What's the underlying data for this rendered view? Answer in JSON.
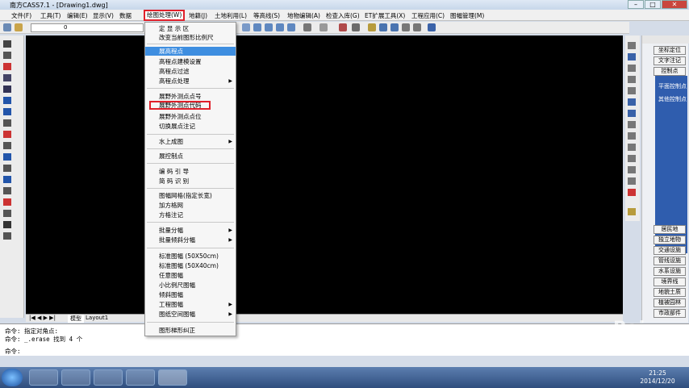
{
  "window": {
    "title": "南方CASS7.1 - [Drawing1.dwg]",
    "minimize": "–",
    "maximize": "□",
    "close": "✕"
  },
  "menubar": [
    "文件(F)",
    "工具(T)",
    "编辑(E)",
    "显示(V)",
    "数据",
    "绘图处理(W)",
    "地籍(J)",
    "土地利用(L)",
    "等高线(S)",
    "地物编辑(A)",
    "检查入库(G)",
    "ET扩展工具(X)",
    "工程应用(C)",
    "图幅管理(M)"
  ],
  "layer_value": "0",
  "dropdown": {
    "items": [
      "定 显 示 区",
      "改变当前图形比例尺",
      "展高程点",
      "高程点建模设置",
      "高程点过滤",
      "高程点处理",
      "展野外测点点号",
      "展野外测点代码",
      "展野外测点点位",
      "切换展点注记",
      "水上成图",
      "展控制点",
      "编 码 引 导",
      "简 码 识 别",
      "图幅网格(指定长宽)",
      "加方格网",
      "方格注记",
      "批量分幅",
      "批量倾斜分幅",
      "标准图幅 (50X50cm)",
      "标准图幅 (50X40cm)",
      "任意图幅",
      "小比例尺图幅",
      "倾斜图幅",
      "工程图幅",
      "图纸空间图幅",
      "图形梯形纠正"
    ]
  },
  "tabs": {
    "model": "模型",
    "layout": "Layout1"
  },
  "command": {
    "line1": "命令: 指定对角点:",
    "line2": "命令: _.erase 找到 4 个",
    "prompt": "命令:"
  },
  "right_panel": {
    "top_buttons": [
      "坐标定位",
      "文字注记",
      "控制点"
    ],
    "blue_items": [
      "平面控制点",
      "其他控制点"
    ],
    "bottom_buttons": [
      "居民地",
      "独立地物",
      "交通设施",
      "管线设施",
      "水系设施",
      "境界线",
      "地貌土质",
      "植被园林",
      "市政部件"
    ]
  },
  "taskbar": {
    "time": "21:25",
    "date": "2014/12/20"
  },
  "watermark": "Bai"
}
